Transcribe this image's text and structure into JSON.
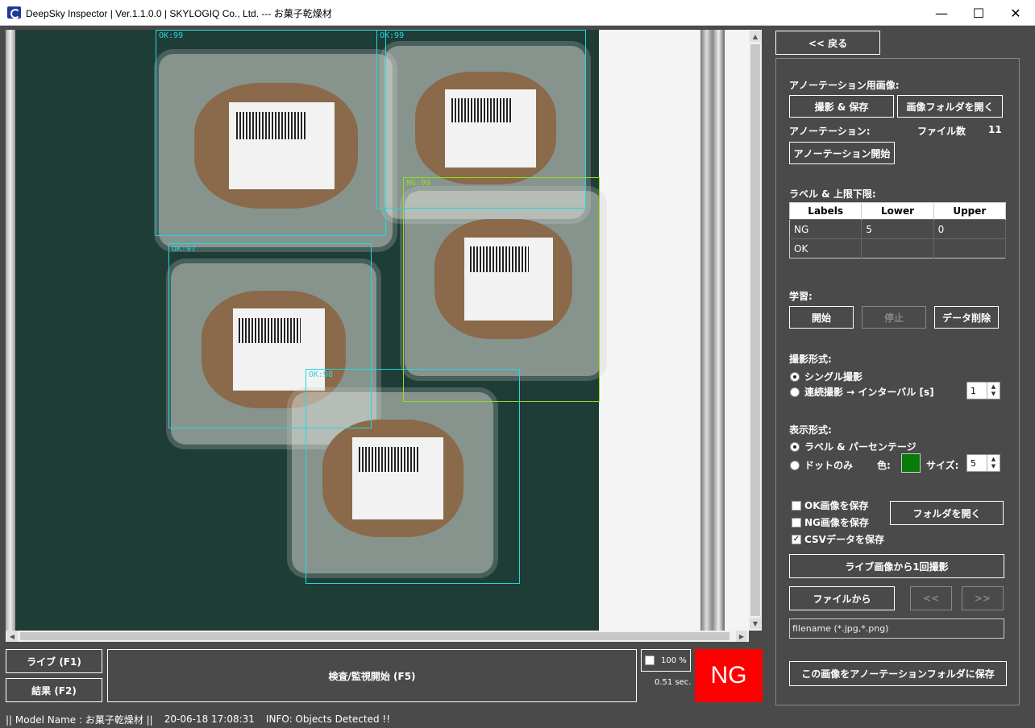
{
  "window": {
    "title": "DeepSky Inspector | Ver.1.1.0.0 | SKYLOGIQ Co., Ltd. --- お菓子乾燥材",
    "minimize": "—",
    "maximize": "☐",
    "close": "✕"
  },
  "detections": [
    {
      "label": "OK:99"
    },
    {
      "label": "OK:99"
    },
    {
      "label": "NG:99"
    },
    {
      "label": "OK:97"
    },
    {
      "label": "OK:98"
    }
  ],
  "bottom": {
    "live_button": "ライブ (F1)",
    "result_button": "結果 (F2)",
    "inspect_button": "検査/監視開始 (F5)",
    "zoom": "100 %",
    "elapsed": "0.51 sec.",
    "judgement": "NG"
  },
  "panel": {
    "back_button": "<< 戻る",
    "annotation_image_heading": "アノーテーション用画像:",
    "capture_save_button": "撮影 & 保存",
    "open_image_folder_button": "画像フォルダを開く",
    "annotation_heading": "アノーテーション:",
    "file_count_label": "ファイル数",
    "file_count": "11",
    "start_annotation_button": "アノーテーション開始",
    "labels_heading": "ラベル & 上限下限:",
    "labels_table": {
      "headers": [
        "Labels",
        "Lower",
        "Upper"
      ],
      "rows": [
        {
          "label": "NG",
          "lower": "5",
          "upper": "0"
        },
        {
          "label": "OK",
          "lower": "",
          "upper": ""
        }
      ]
    },
    "training_heading": "学習:",
    "train_start_button": "開始",
    "train_stop_button": "停止",
    "delete_data_button": "データ削除",
    "capture_mode_heading": "撮影形式:",
    "single_capture": "シングル撮影",
    "continuous_capture": "連続撮影 → インターバル [s]",
    "interval_value": "1",
    "display_mode_heading": "表示形式:",
    "label_percentage": "ラベル & パーセンテージ",
    "dot_only": "ドットのみ",
    "color_label": "色:",
    "dot_color": "#0a7a0a",
    "size_label": "サイズ:",
    "size_value": "5",
    "save_ok_images": "OK画像を保存",
    "save_ng_images": "NG画像を保存",
    "save_csv": "CSVデータを保存",
    "open_folder_button": "フォルダを開く",
    "capture_from_live_button": "ライブ画像から1回撮影",
    "from_file_button": "ファイルから",
    "prev_button": "<<",
    "next_button": ">>",
    "filename": "filename (*.jpg,*.png)",
    "save_to_annotation_button": "この画像をアノーテーションフォルダに保存"
  },
  "status": {
    "model": "|| Model Name : お菓子乾燥材 ||",
    "datetime": "20-06-18 17:08:31",
    "info": "INFO:   Objects Detected !!"
  }
}
